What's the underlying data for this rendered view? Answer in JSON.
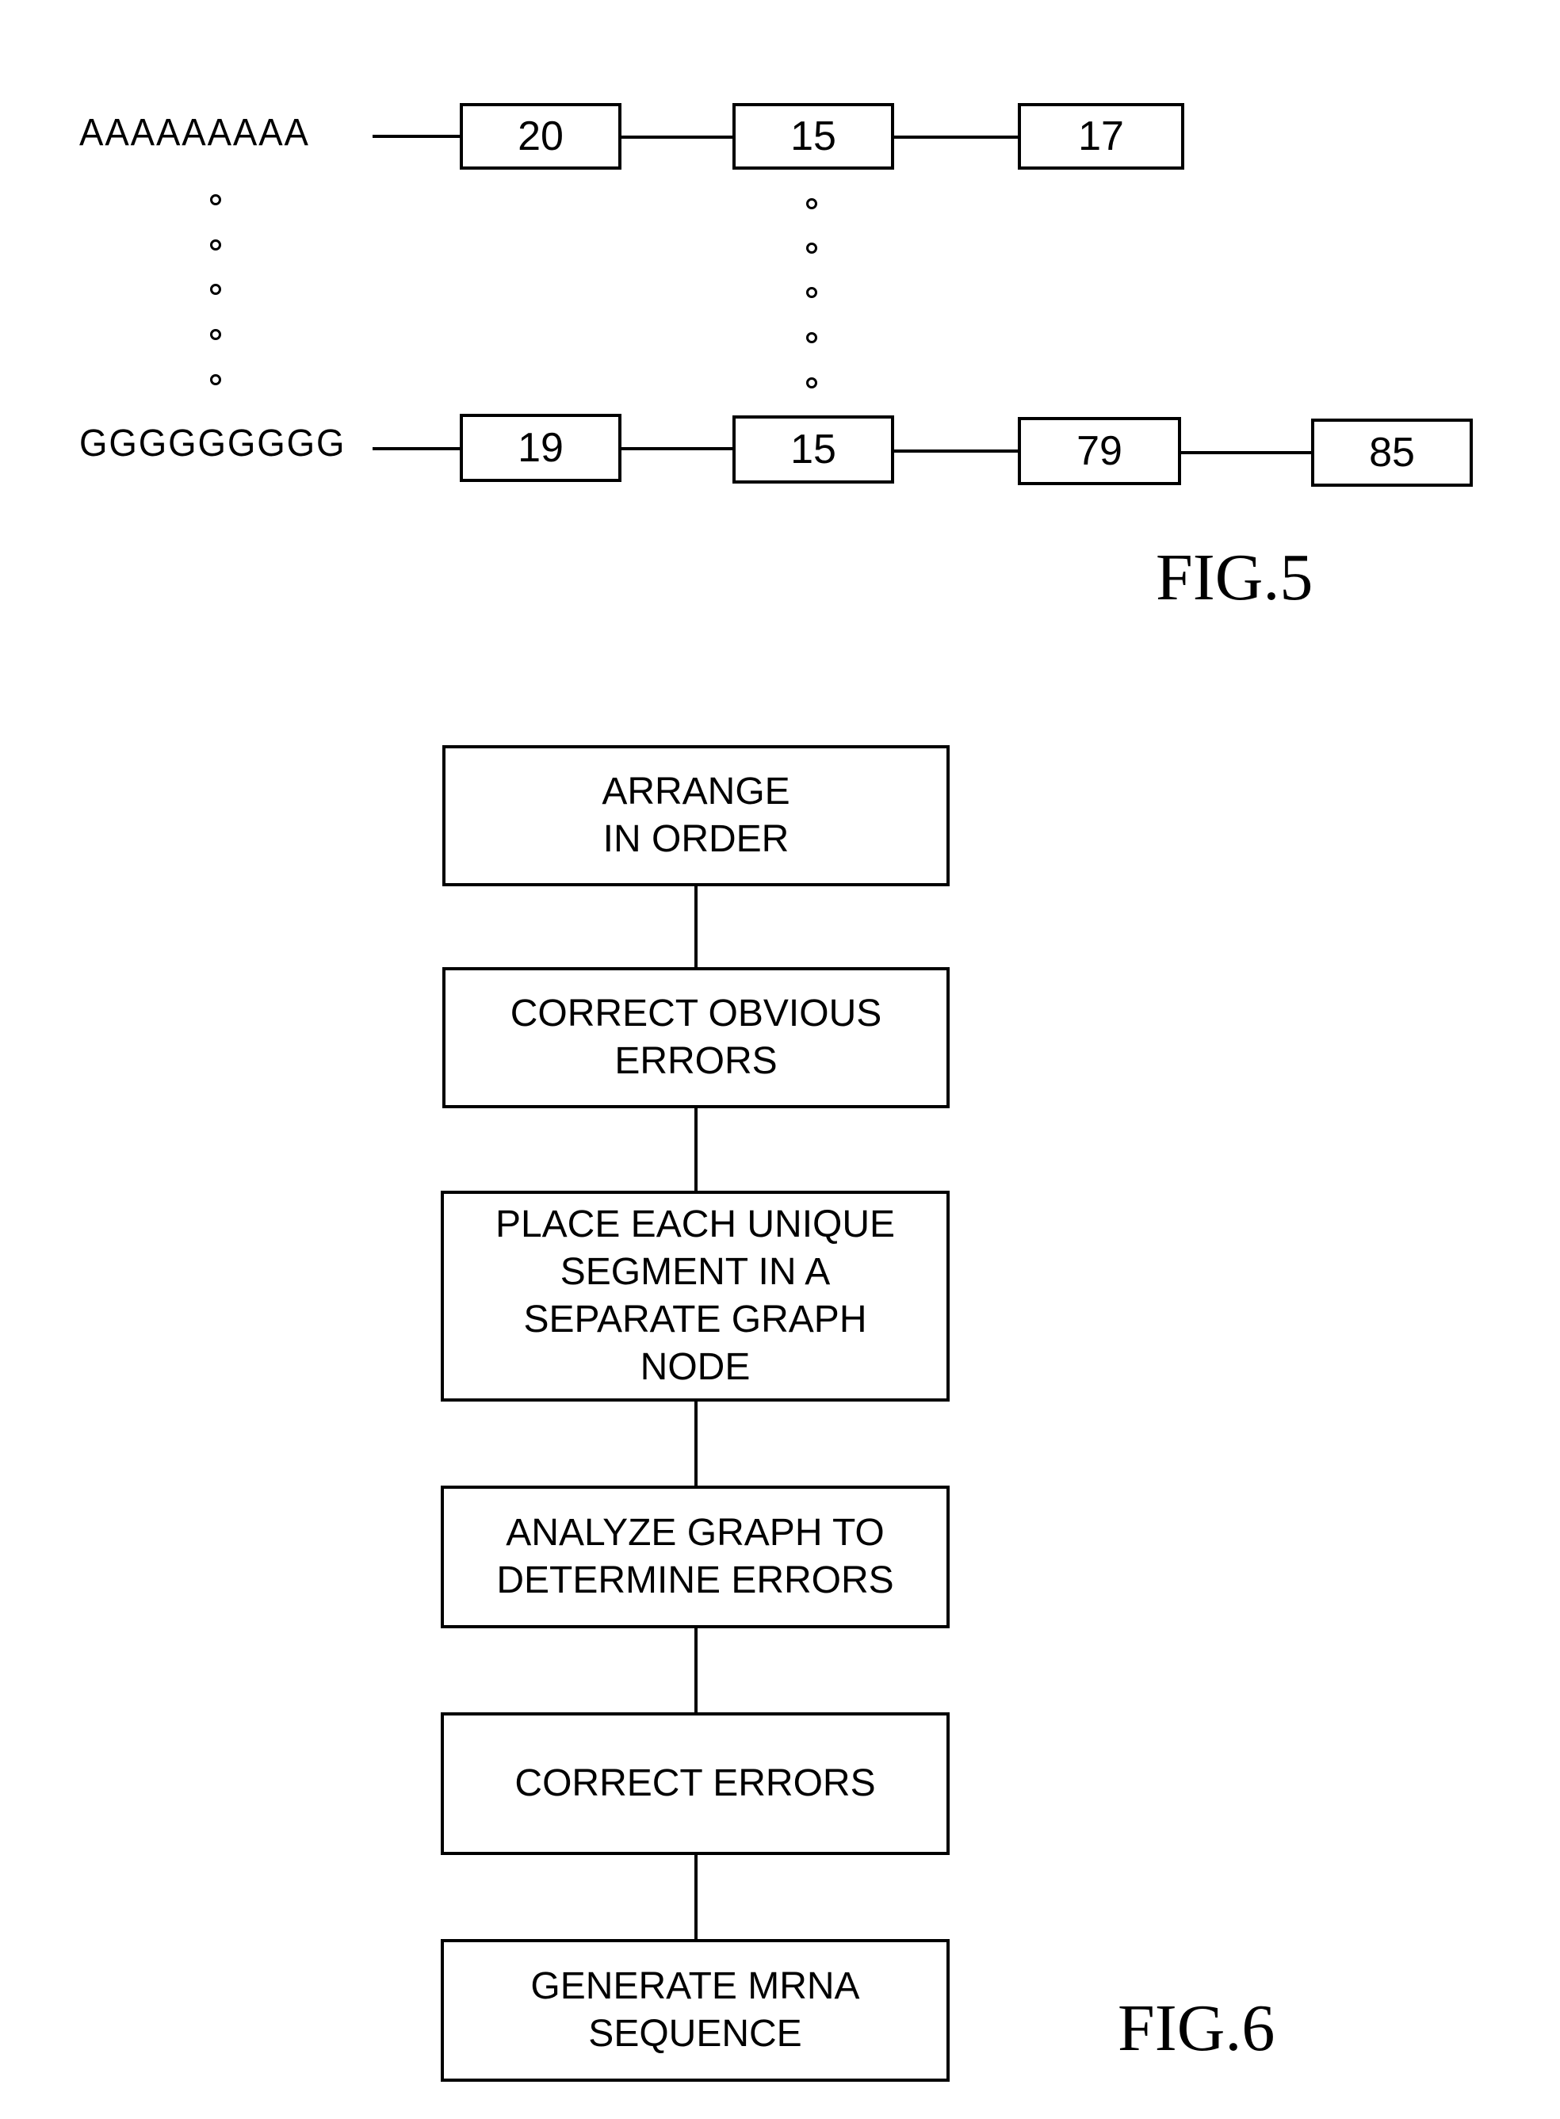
{
  "fig5": {
    "title": "FIG.5",
    "rows": [
      {
        "sequence": "AAAAAAAAA",
        "nodes": [
          "20",
          "15",
          "17"
        ]
      },
      {
        "sequence": "GGGGGGGGG",
        "nodes": [
          "19",
          "15",
          "79",
          "85"
        ]
      }
    ]
  },
  "fig6": {
    "title": "FIG.6",
    "steps": [
      "ARRANGE\nIN ORDER",
      "CORRECT OBVIOUS\nERRORS",
      "PLACE EACH UNIQUE\nSEGMENT IN A\nSEPARATE GRAPH\nNODE",
      "ANALYZE GRAPH  TO\nDETERMINE ERRORS",
      "CORRECT ERRORS",
      "GENERATE MRNA\nSEQUENCE"
    ]
  }
}
